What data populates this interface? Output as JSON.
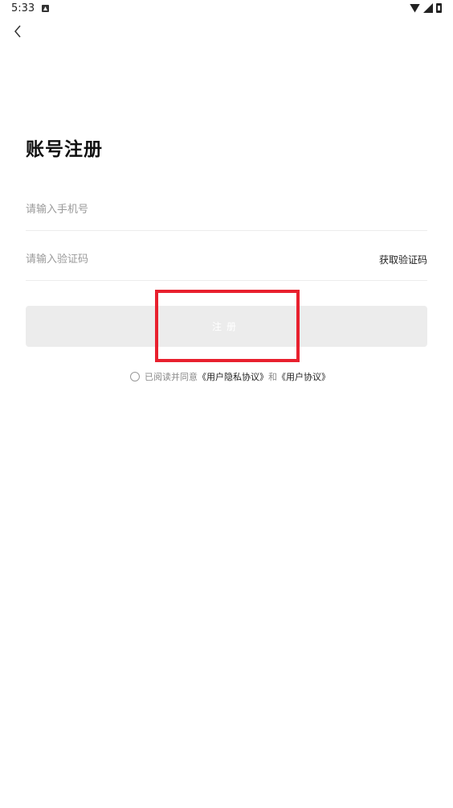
{
  "status_bar": {
    "time": "5:33"
  },
  "header": {
    "back_icon": "chevron-left-icon"
  },
  "page": {
    "title": "账号注册"
  },
  "form": {
    "phone_placeholder": "请输入手机号",
    "code_placeholder": "请输入验证码",
    "get_code_label": "获取验证码",
    "register_label": "注册"
  },
  "agreement": {
    "prefix": "已阅读并同意",
    "privacy_link": "《用户隐私协议》",
    "conjunction": "和",
    "user_link": "《用户协议》"
  },
  "colors": {
    "button_bg": "#ececec",
    "highlight": "#e8202e"
  }
}
